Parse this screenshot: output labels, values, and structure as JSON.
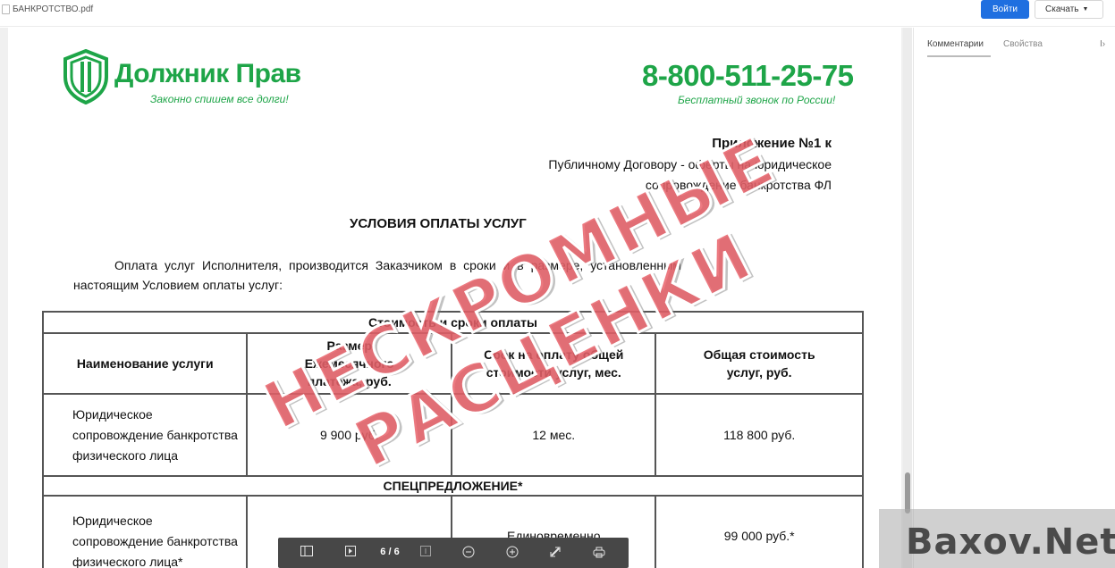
{
  "window": {
    "file_name": "БАНКРОТСТВО.pdf",
    "login_label": "Войти",
    "download_label": "Скачать"
  },
  "sidebar": {
    "tabs": [
      {
        "label": "Комментарии",
        "active": true
      },
      {
        "label": "Свойства",
        "active": false
      }
    ],
    "close_label": "I›"
  },
  "document": {
    "company_name": "Должник Прав",
    "company_tagline": "Законно спишем все долги!",
    "phone": "8-800-511-25-75",
    "phone_note": "Бесплатный звонок по России!",
    "appendix_title": "Приложение №1 к",
    "appendix_line1": "Публичному Договору - оферты на юридическое",
    "appendix_line2": "сопровождение банкротства ФЛ",
    "title": "УСЛОВИЯ ОПЛАТЫ УСЛУГ",
    "paragraph_line1": "Оплата услуг Исполнителя, производится Заказчиком в сроки и в размере, установленным",
    "paragraph_line2": "настоящим Условием оплаты услуг:",
    "table": {
      "merged_header": "Стоимость и сроки оплаты",
      "headers": [
        "Наименование услуги",
        "Размер Ежемесячного платежа, руб.",
        "Срок на оплату общей стоимости услуг, мес.",
        "Общая стоимость услуг, руб."
      ],
      "row1": {
        "name": "Юридическое сопровождение банкротства физического лица",
        "monthly": "9 900 руб.",
        "term": "12 мес.",
        "total": "118 800 руб."
      },
      "special_offer": "СПЕЦПРЕДЛОЖЕНИЕ*",
      "row2": {
        "name": "Юридическое сопровождение банкротства физического лица*",
        "monthly": "-",
        "term": "Единовременно",
        "total": "99 000 руб.*"
      }
    }
  },
  "stamp": {
    "line1": "НЕСКРОМНЫЕ",
    "line2": "РАСЦЕНКИ"
  },
  "toolbar": {
    "page_indicator": "6 / 6"
  },
  "watermark": {
    "text": "Baxov.Net"
  }
}
